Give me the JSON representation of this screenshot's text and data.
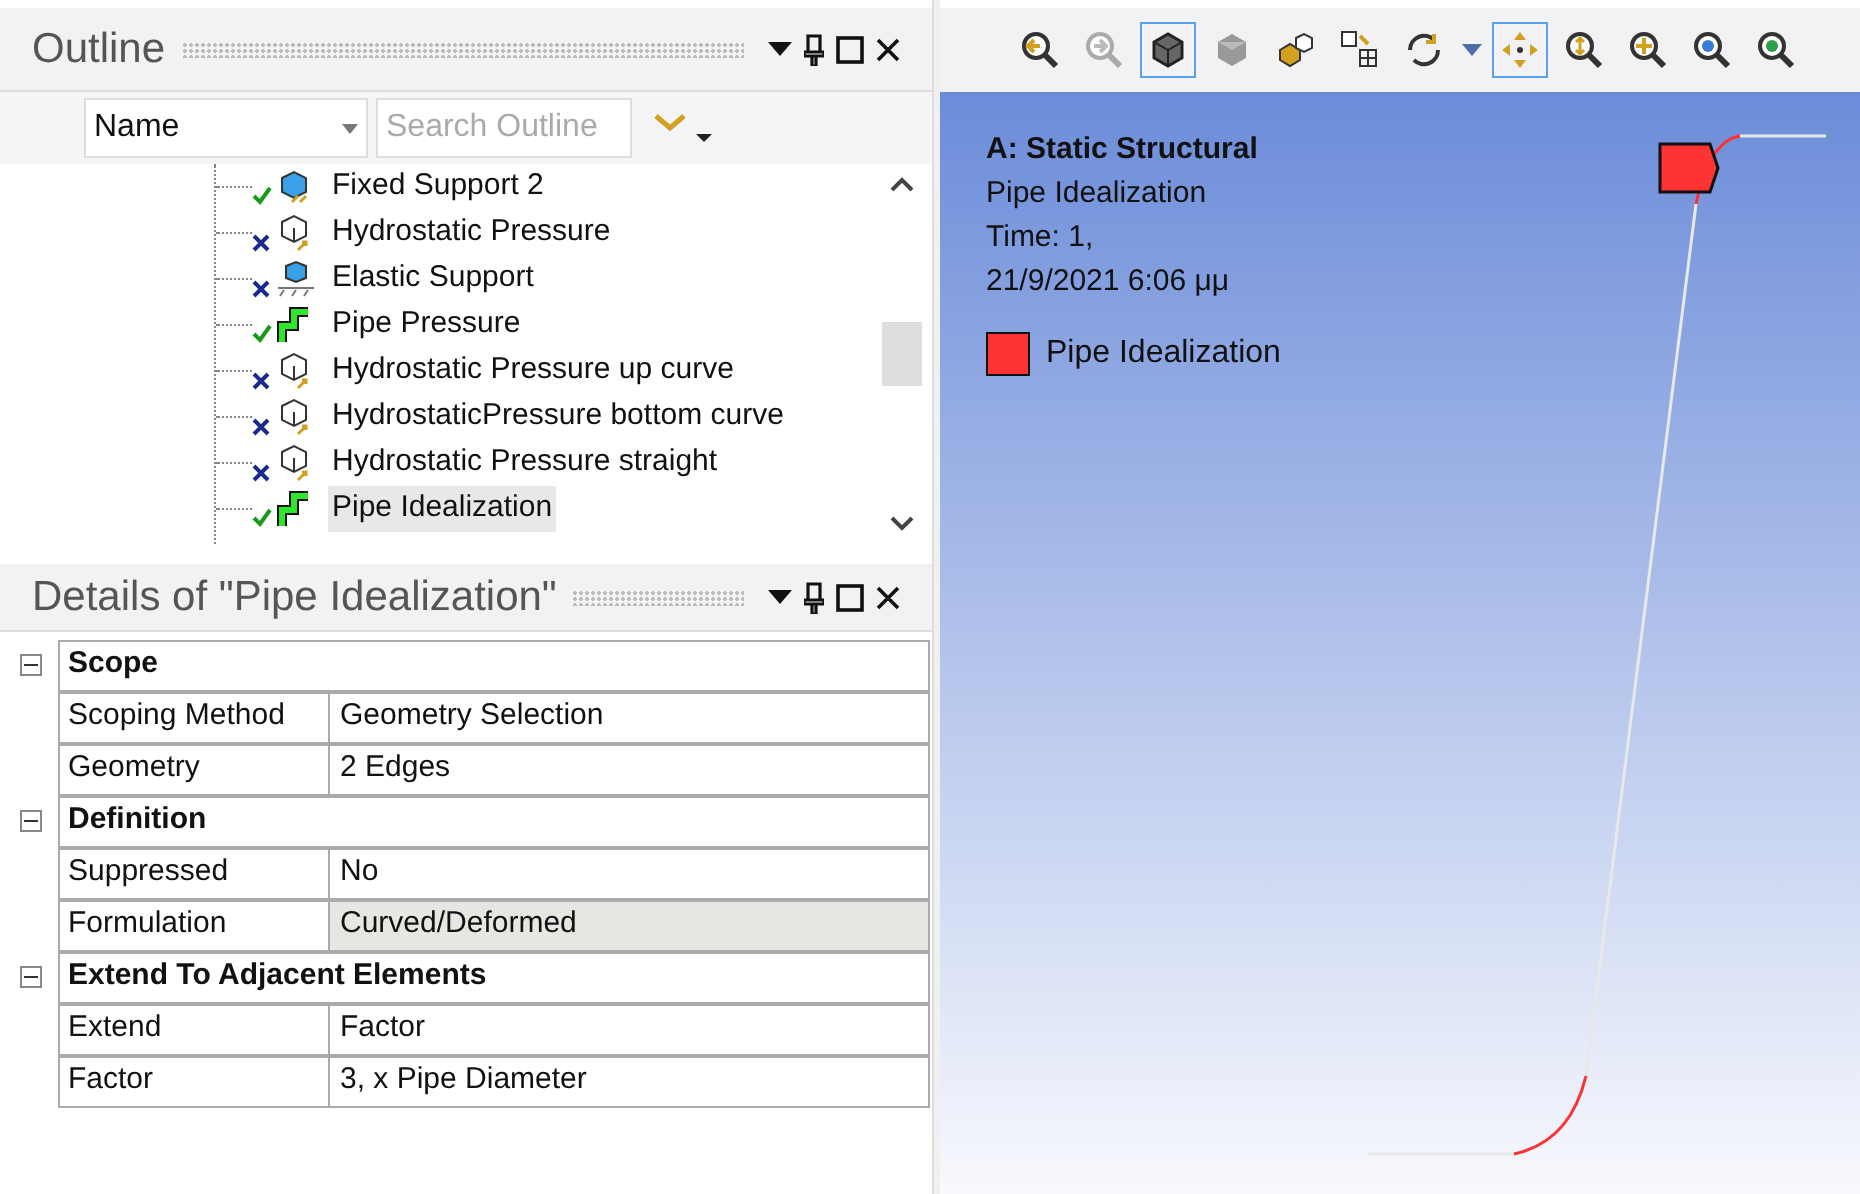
{
  "outline": {
    "title": "Outline",
    "column_select": {
      "value": "Name"
    },
    "search": {
      "placeholder": "Search Outline"
    },
    "items": [
      {
        "label": "Fixed Support 2",
        "valid": true,
        "kind": "support",
        "selected": false
      },
      {
        "label": "Hydrostatic Pressure",
        "valid": false,
        "kind": "pressure",
        "selected": false
      },
      {
        "label": "Elastic Support",
        "valid": false,
        "kind": "elastic",
        "selected": false
      },
      {
        "label": "Pipe Pressure",
        "valid": true,
        "kind": "pipe",
        "selected": false
      },
      {
        "label": "Hydrostatic Pressure up curve",
        "valid": false,
        "kind": "pressure",
        "selected": false
      },
      {
        "label": "HydrostaticPressure bottom curve",
        "valid": false,
        "kind": "pressure",
        "selected": false
      },
      {
        "label": "Hydrostatic Pressure straight",
        "valid": false,
        "kind": "pressure",
        "selected": false
      },
      {
        "label": "Pipe Idealization",
        "valid": true,
        "kind": "pipe",
        "selected": true
      }
    ]
  },
  "details": {
    "title": "Details of \"Pipe Idealization\"",
    "rows": [
      {
        "kind": "section",
        "label": "Scope",
        "expanded": true
      },
      {
        "kind": "property",
        "label": "Scoping Method",
        "value": "Geometry Selection",
        "highlighted": false
      },
      {
        "kind": "property",
        "label": "Geometry",
        "value": "2 Edges",
        "highlighted": false
      },
      {
        "kind": "section",
        "label": "Definition",
        "expanded": true
      },
      {
        "kind": "property",
        "label": "Suppressed",
        "value": "No",
        "highlighted": false
      },
      {
        "kind": "property",
        "label": "Formulation",
        "value": "Curved/Deformed",
        "highlighted": true
      },
      {
        "kind": "section",
        "label": "Extend To Adjacent Elements",
        "expanded": true
      },
      {
        "kind": "property",
        "label": "Extend",
        "value": "Factor",
        "highlighted": false
      },
      {
        "kind": "property",
        "label": "Factor",
        "value": "3, x Pipe Diameter",
        "highlighted": false
      }
    ]
  },
  "toolbar": [
    {
      "kind": "zoom-back",
      "selected": false
    },
    {
      "kind": "zoom-forward",
      "selected": false
    },
    {
      "kind": "shaded-edges",
      "selected": true
    },
    {
      "kind": "shaded",
      "selected": false
    },
    {
      "kind": "wireframe",
      "selected": false
    },
    {
      "kind": "viewports",
      "selected": false
    },
    {
      "kind": "rotate",
      "selected": false
    },
    {
      "kind": "dropdown",
      "selected": false
    },
    {
      "kind": "pan",
      "selected": true
    },
    {
      "kind": "zoom",
      "selected": false
    },
    {
      "kind": "box-zoom",
      "selected": false
    },
    {
      "kind": "zoom-fit",
      "selected": false
    },
    {
      "kind": "zoom-to-active",
      "selected": false
    }
  ],
  "viewport": {
    "analysis": "A: Static Structural",
    "object": "Pipe Idealization",
    "time": "Time: 1,",
    "date": "21/9/2021 6:06 μμ",
    "legend": [
      {
        "label": "Pipe Idealization",
        "color": "#ff3333"
      }
    ]
  }
}
